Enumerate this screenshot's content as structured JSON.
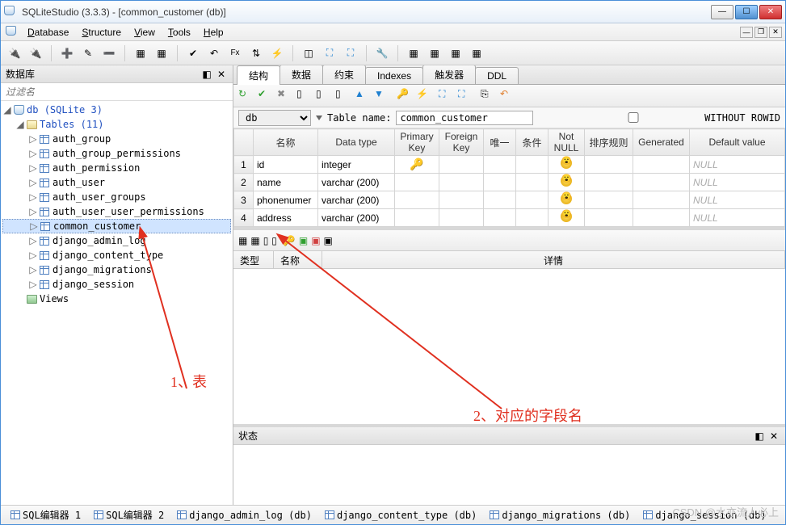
{
  "window": {
    "title": "SQLiteStudio (3.3.3) - [common_customer (db)]"
  },
  "menus": [
    "Database",
    "Structure",
    "View",
    "Tools",
    "Help"
  ],
  "sidebar": {
    "title": "数据库",
    "filter_placeholder": "过滤名",
    "db_label": "db",
    "db_type": "(SQLite 3)",
    "tables_label": "Tables",
    "tables_count": "(11)",
    "views_label": "Views",
    "tables": [
      "auth_group",
      "auth_group_permissions",
      "auth_permission",
      "auth_user",
      "auth_user_groups",
      "auth_user_user_permissions",
      "common_customer",
      "django_admin_log",
      "django_content_type",
      "django_migrations",
      "django_session"
    ],
    "selected_index": 6
  },
  "tabs": [
    "结构",
    "数据",
    "约束",
    "Indexes",
    "触发器",
    "DDL"
  ],
  "tablename": {
    "db_label": "db",
    "label": "Table name:",
    "value": "common_customer",
    "without_rowid": "WITHOUT ROWID"
  },
  "cols": {
    "name": "名称",
    "datatype": "Data type",
    "pk": "Primary\nKey",
    "fk": "Foreign\nKey",
    "unique": "唯一",
    "cond": "条件",
    "notnull": "Not\nNULL",
    "sort": "排序规则",
    "gen": "Generated",
    "default": "Default value"
  },
  "rows": [
    {
      "n": "1",
      "name": "id",
      "type": "integer",
      "pk": true,
      "notnull": true,
      "def": "NULL"
    },
    {
      "n": "2",
      "name": "name",
      "type": "varchar (200)",
      "pk": false,
      "notnull": true,
      "def": "NULL"
    },
    {
      "n": "3",
      "name": "phonenumer",
      "type": "varchar (200)",
      "pk": false,
      "notnull": true,
      "def": "NULL"
    },
    {
      "n": "4",
      "name": "address",
      "type": "varchar (200)",
      "pk": false,
      "notnull": true,
      "def": "NULL"
    }
  ],
  "detail_hdr": {
    "type": "类型",
    "name": "名称",
    "detail": "详情"
  },
  "status_title": "状态",
  "bottom_tabs": [
    "SQL编辑器 1",
    "SQL编辑器 2",
    "django_admin_log (db)",
    "django_content_type (db)",
    "django_migrations (db)",
    "django_session (db)"
  ],
  "annot": {
    "a1": "1、表",
    "a2": "2、对应的字段名"
  },
  "watermark": "CSDN @水亦流人必上"
}
